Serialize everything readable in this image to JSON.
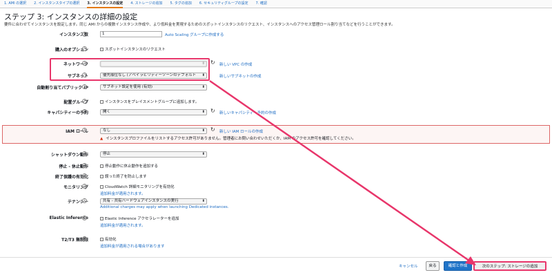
{
  "tabs": [
    "1. AMI の選択",
    "2. インスタンスタイプの選択",
    "3. インスタンスの設定",
    "4. ストレージの追加",
    "5. タグの追加",
    "6. セキュリティグループの設定",
    "7. 確認"
  ],
  "title": "ステップ 3: インスタンスの詳細の設定",
  "description": "要件に合わせてインスタンスを設定します。同じ AMI からの複数インスタンス作成や、より低料金を実現するためのスポットインスタンスのリクエスト、インスタンスへのアクセス管理ロール割り当てなどを行うことができます。",
  "info_glyph": "i",
  "fields": {
    "count_label": "インスタンス数",
    "count_value": "1",
    "count_link": "Auto Scaling グループに作成する",
    "purchase_label": "購入のオプション",
    "purchase_check": "スポットインスタンスのリクエスト",
    "network_label": "ネットワーク",
    "network_link": "新しい VPC の作成",
    "subnet_label": "サブネット",
    "subnet_value": "優先順位なし (アベイラビリティーゾーンのデフォルト",
    "subnet_link": "新しいサブネットの作成",
    "publicip_label": "自動割り当てパブリック IP",
    "publicip_value": "サブネット設定を使用 (有効)",
    "placement_label": "配置グループ",
    "placement_check": "インスタンスをプレイスメントグループに追加します。",
    "capacity_label": "キャパシティーの予約",
    "capacity_value": "開く",
    "capacity_link": "新しいキャパシティー予約の作成",
    "iam_label": "IAM ロール",
    "iam_value": "なし",
    "iam_link": "新しい IAM ロールの作成",
    "iam_warning": "インスタンスプロファイルをリストするアクセス許可がありません。管理者にお問い合わせいただくか、IAM のアクセス許可を確認してください。",
    "shutdown_label": "シャットダウン動作",
    "shutdown_value": "停止",
    "stop_label": "停止 - 休止動作",
    "stop_check": "停止動作に休止動作を追加する",
    "term_label": "終了保護の有効化",
    "term_check": "誤った終了を防止します",
    "monitor_label": "モニタリング",
    "monitor_check": "CloudWatch 詳細モニタリングを有効化",
    "monitor_sub": "追加料金が適用されます。",
    "tenancy_label": "テナンシー",
    "tenancy_value": "共有 - 共有ハードウェアインスタンスの実行",
    "tenancy_sub": "Additional charges may apply when launching Dedicated instances.",
    "ei_label": "Elastic Inference",
    "ei_check": "Elastic Inference アクセラレーターを追加",
    "ei_sub": "追加料金が適用されます。",
    "t2_label": "T2/T3 無制限",
    "t2_check": "有効化",
    "t2_sub": "追加料金が適用される場合があります"
  },
  "buttons": {
    "cancel": "キャンセル",
    "back": "戻る",
    "review": "確認と作成",
    "next": "次のステップ: ストレージの追加"
  },
  "icons": {
    "refresh": "↻",
    "arrow": "⬍",
    "warning": "▲"
  }
}
